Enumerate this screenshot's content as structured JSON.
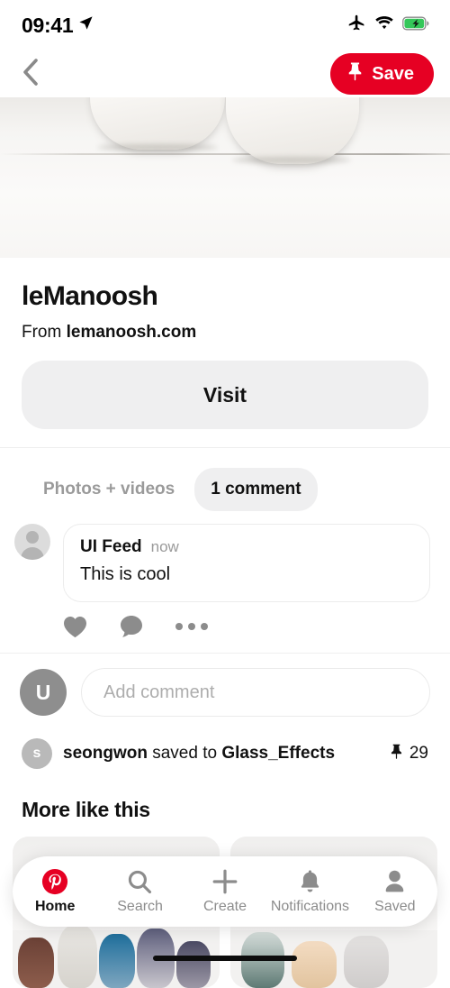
{
  "status_bar": {
    "time": "09:41",
    "icons": [
      "location-arrow-icon",
      "airplane-mode-icon",
      "wifi-icon",
      "battery-charging-icon"
    ]
  },
  "header": {
    "back_icon": "chevron-left-icon",
    "save_label": "Save",
    "save_icon": "pushpin-icon",
    "accent_color": "#e60023"
  },
  "pin": {
    "title": "leManoosh",
    "source_prefix": "From",
    "source_domain": "lemanoosh.com",
    "visit_label": "Visit"
  },
  "tabs": [
    {
      "label": "Photos + videos",
      "active": false
    },
    {
      "label": "1 comment",
      "active": true
    }
  ],
  "comment": {
    "author": "UI Feed",
    "time": "now",
    "text": "This is cool",
    "actions": [
      "heart-icon",
      "comment-bubble-icon",
      "ellipsis-icon"
    ]
  },
  "add_comment": {
    "avatar_initial": "U",
    "placeholder": "Add comment",
    "value": ""
  },
  "saved_by": {
    "avatar_initial": "s",
    "user": "seongwon",
    "middle_text": " saved to ",
    "board": "Glass_Effects",
    "pin_icon": "pushpin-icon",
    "save_count": "29"
  },
  "more_like_this": {
    "heading": "More like this"
  },
  "bottom_nav": [
    {
      "label": "Home",
      "icon": "pinterest-logo-icon",
      "active": true
    },
    {
      "label": "Search",
      "icon": "search-icon",
      "active": false
    },
    {
      "label": "Create",
      "icon": "plus-icon",
      "active": false
    },
    {
      "label": "Notifications",
      "icon": "bell-icon",
      "active": false
    },
    {
      "label": "Saved",
      "icon": "person-icon",
      "active": false
    }
  ]
}
